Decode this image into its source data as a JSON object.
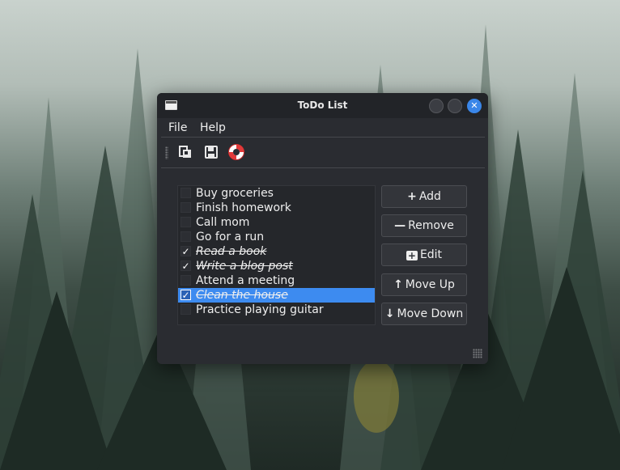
{
  "window": {
    "title": "ToDo List",
    "close_glyph": "✕"
  },
  "menubar": {
    "items": [
      {
        "label": "File"
      },
      {
        "label": "Help"
      }
    ]
  },
  "toolbar": {
    "icons": [
      "new-document-icon",
      "save-icon",
      "help-lifebuoy-icon"
    ]
  },
  "todo": {
    "items": [
      {
        "label": "Buy groceries",
        "checked": false
      },
      {
        "label": "Finish homework",
        "checked": false
      },
      {
        "label": "Call mom",
        "checked": false
      },
      {
        "label": "Go for a run",
        "checked": false
      },
      {
        "label": "Read a book",
        "checked": true
      },
      {
        "label": "Write a blog post",
        "checked": true
      },
      {
        "label": "Attend a meeting",
        "checked": false
      },
      {
        "label": "Clean the house",
        "checked": true,
        "selected": true
      },
      {
        "label": "Practice playing guitar",
        "checked": false
      }
    ],
    "check_glyph": "✓"
  },
  "buttons": {
    "add": {
      "icon": "+",
      "label": "Add"
    },
    "remove": {
      "icon": "—",
      "label": "Remove"
    },
    "edit": {
      "icon": "+",
      "label": "Edit"
    },
    "move_up": {
      "icon": "↑",
      "label": "Move Up"
    },
    "move_down": {
      "icon": "↓",
      "label": "Move Down"
    }
  },
  "colors": {
    "accent": "#3d8bf0",
    "window_bg": "#2a2c31",
    "close_button": "#3a86e8"
  }
}
